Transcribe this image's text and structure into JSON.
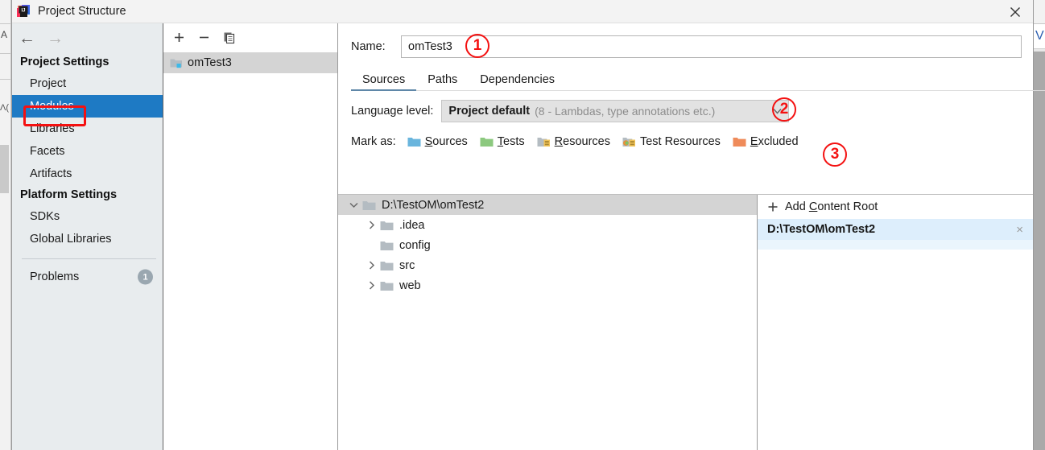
{
  "window": {
    "title": "Project Structure",
    "app_icon": "intellij-idea-icon",
    "close_label": "×"
  },
  "background": {
    "left_letter": "A",
    "left_letter2": "Λ(",
    "right_letter": "V"
  },
  "sidebar": {
    "nav": {
      "back": "←",
      "forward": "→"
    },
    "groups": [
      {
        "title": "Project Settings",
        "items": [
          {
            "label": "Project",
            "selected": false
          },
          {
            "label": "Modules",
            "selected": true
          },
          {
            "label": "Libraries",
            "selected": false
          },
          {
            "label": "Facets",
            "selected": false
          },
          {
            "label": "Artifacts",
            "selected": false
          }
        ]
      },
      {
        "title": "Platform Settings",
        "items": [
          {
            "label": "SDKs",
            "selected": false
          },
          {
            "label": "Global Libraries",
            "selected": false
          }
        ]
      }
    ],
    "problems": {
      "label": "Problems",
      "badge": "1"
    }
  },
  "modules_panel": {
    "toolbar": [
      {
        "name": "add-module-button",
        "glyph": "+"
      },
      {
        "name": "remove-module-button",
        "glyph": "−"
      },
      {
        "name": "copy-module-button",
        "glyph": "copy-icon"
      }
    ],
    "modules": [
      {
        "label": "omTest3",
        "selected": true
      }
    ]
  },
  "content": {
    "name": {
      "label": "Name:",
      "value": "omTest3",
      "placeholder": ""
    },
    "tabs": [
      {
        "label": "Sources",
        "active": true
      },
      {
        "label": "Paths",
        "active": false
      },
      {
        "label": "Dependencies",
        "active": false
      }
    ],
    "language_level": {
      "label": "Language level:",
      "value": "Project default",
      "hint": "(8 - Lambdas, type annotations etc.)"
    },
    "mark_as": {
      "label": "Mark as:",
      "options": [
        {
          "label": "Sources",
          "mnemonic": "S",
          "rest": "ources",
          "icon": "folder-sources-icon",
          "color": "#69b5dd"
        },
        {
          "label": "Tests",
          "mnemonic": "T",
          "rest": "ests",
          "icon": "folder-tests-icon",
          "color": "#8cc97f"
        },
        {
          "label": "Resources",
          "mnemonic": "R",
          "rest": "esources",
          "icon": "folder-resources-icon",
          "color": "#b4bcc2"
        },
        {
          "label": "Test Resources",
          "mnemonic": "",
          "rest": "Test Resources",
          "icon": "folder-test-resources-icon",
          "color": "#e8903a"
        },
        {
          "label": "Excluded",
          "mnemonic": "E",
          "rest": "xcluded",
          "icon": "folder-excluded-icon",
          "color": "#ef8b5a"
        }
      ]
    },
    "tree": [
      {
        "label": "D:\\TestOM\\omTest2",
        "depth": 0,
        "twisty": "expanded",
        "selected": true
      },
      {
        "label": ".idea",
        "depth": 1,
        "twisty": "collapsed",
        "selected": false
      },
      {
        "label": "config",
        "depth": 1,
        "twisty": "none",
        "selected": false
      },
      {
        "label": "src",
        "depth": 1,
        "twisty": "collapsed",
        "selected": false
      },
      {
        "label": "web",
        "depth": 1,
        "twisty": "collapsed",
        "selected": false
      }
    ],
    "content_roots": {
      "add_label_mnemonic": "Add ",
      "add_label_underlined": "C",
      "add_label_rest": "ontent Root",
      "add_glyph": "+",
      "roots": [
        {
          "path": "D:\\TestOM\\omTest2",
          "remove": "×"
        }
      ]
    }
  },
  "annotations": {
    "color": "#f41111",
    "markers": [
      {
        "id": "1",
        "target": "name-input"
      },
      {
        "id": "2",
        "target": "language-level-dropdown"
      },
      {
        "id": "3",
        "target": "mark-as-row"
      }
    ],
    "highlight_box": {
      "target": "sidebar-item-modules"
    }
  }
}
